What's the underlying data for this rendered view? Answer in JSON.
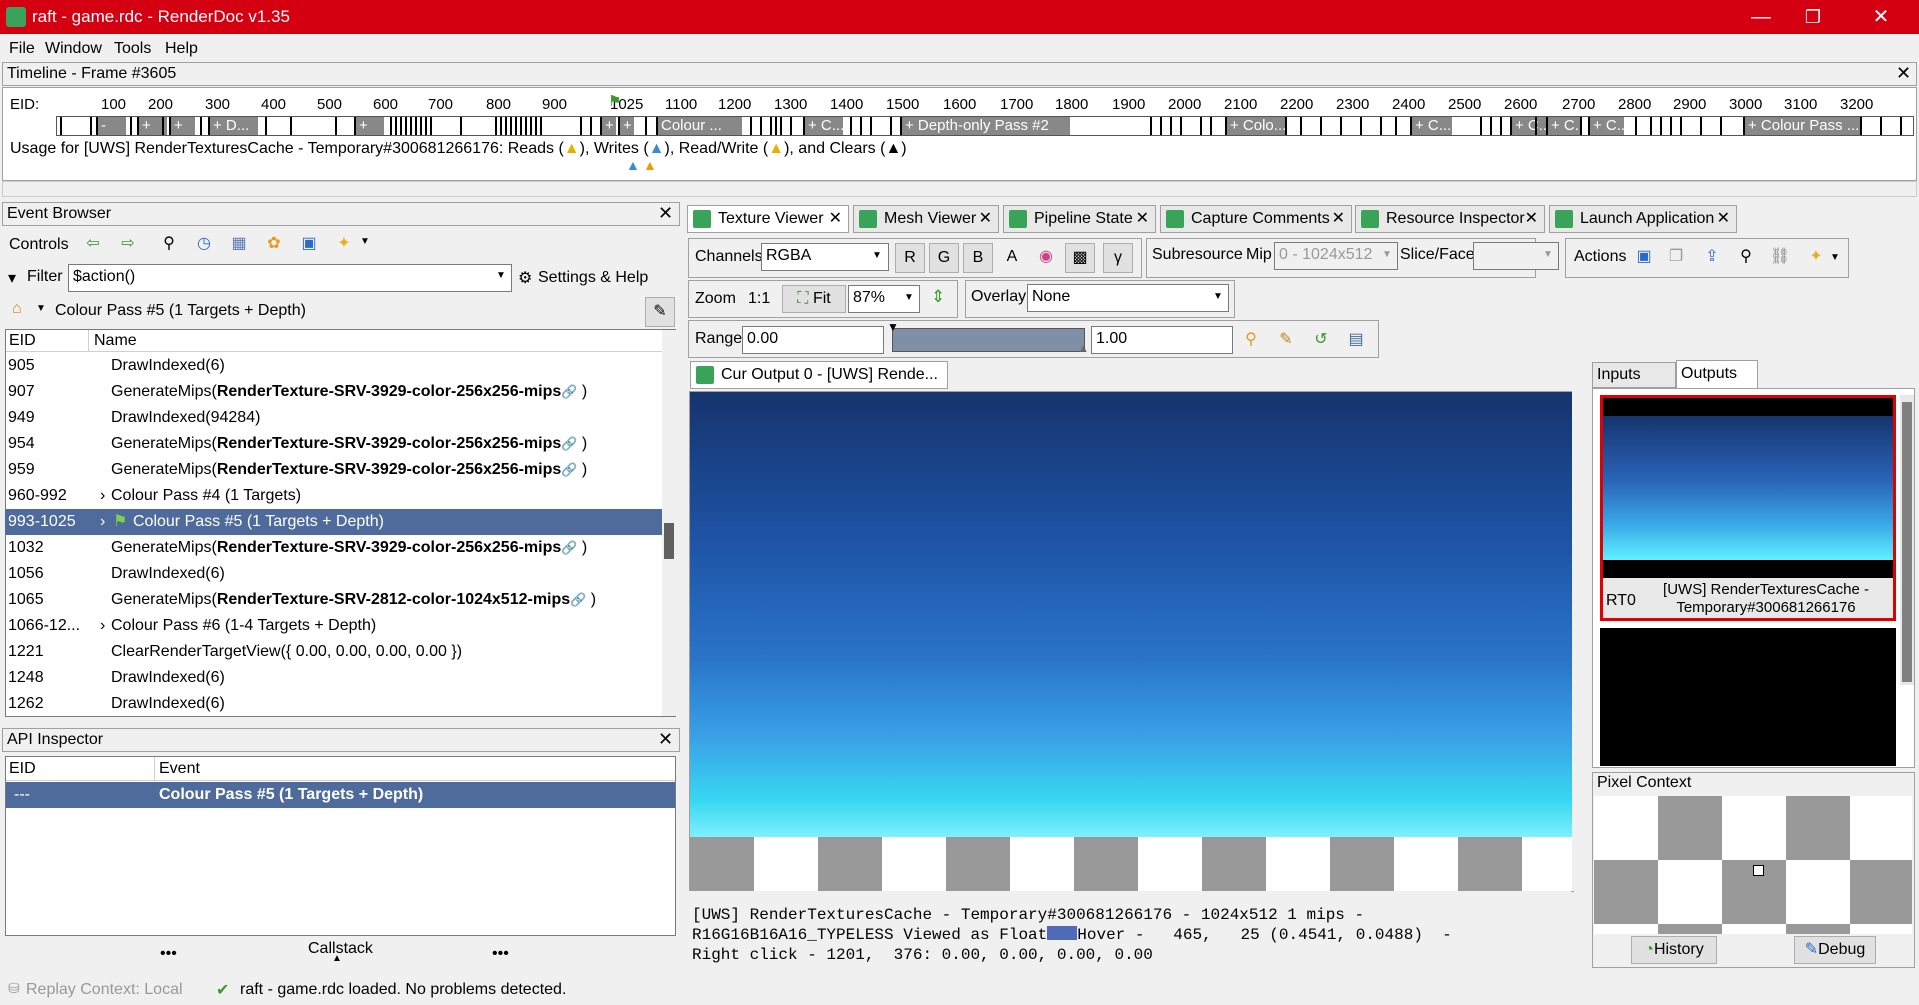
{
  "window": {
    "title": "raft - game.rdc - RenderDoc v1.35",
    "minimize": "—",
    "maximize": "❐",
    "close": "✕"
  },
  "menu": [
    "File",
    "Window",
    "Tools",
    "Help"
  ],
  "timeline": {
    "title": "Timeline - Frame #3605",
    "eid_label": "EID:",
    "ticks": [
      "100",
      "200",
      "300",
      "400",
      "500",
      "600",
      "700",
      "800",
      "900",
      "1025",
      "1100",
      "1200",
      "1300",
      "1400",
      "1500",
      "1600",
      "1700",
      "1800",
      "1900",
      "2000",
      "2100",
      "2200",
      "2300",
      "2400",
      "2500",
      "2600",
      "2700",
      "2800",
      "2900",
      "3000",
      "3100",
      "3200"
    ],
    "passes": [
      "-",
      "+",
      "+",
      "+ D...",
      "+",
      "+",
      "+",
      "Colour ...",
      "+ C...",
      "+ Depth-only Pass #2",
      "+ Colo...",
      "+ C...",
      "+ C...",
      "+ C...",
      "+ C...",
      "+ Colour Pass ..."
    ],
    "usage": "Usage for [UWS] RenderTexturesCache - Temporary#300681266176: Reads (",
    "usage_writes": "), Writes (",
    "usage_rw": "), Read/Write (",
    "usage_clears": "), and Clears (",
    "usage_end": ")"
  },
  "event_browser": {
    "title": "Event Browser",
    "controls": "Controls",
    "filter_label": "Filter",
    "filter_value": "$action()",
    "settings": "Settings & Help",
    "breadcrumb": "Colour Pass #5 (1 Targets + Depth)",
    "col_eid": "EID",
    "col_name": "Name",
    "rows": [
      {
        "eid": "905",
        "pre": "DrawIndexed(6)",
        "b": "",
        "post": ""
      },
      {
        "eid": "907",
        "pre": "GenerateMips(",
        "b": "RenderTexture-SRV-3929-color-256x256-mips",
        "post": " )"
      },
      {
        "eid": "949",
        "pre": "DrawIndexed(94284)",
        "b": "",
        "post": ""
      },
      {
        "eid": "954",
        "pre": "GenerateMips(",
        "b": "RenderTexture-SRV-3929-color-256x256-mips",
        "post": " )"
      },
      {
        "eid": "959",
        "pre": "GenerateMips(",
        "b": "RenderTexture-SRV-3929-color-256x256-mips",
        "post": " )"
      },
      {
        "eid": "960-992",
        "pre": "Colour Pass #4 (1 Targets)",
        "b": "",
        "post": ""
      },
      {
        "eid": "993-1025",
        "pre": "Colour Pass #5 (1 Targets + Depth)",
        "b": "",
        "post": ""
      },
      {
        "eid": "1032",
        "pre": "GenerateMips(",
        "b": "RenderTexture-SRV-3929-color-256x256-mips",
        "post": " )"
      },
      {
        "eid": "1056",
        "pre": "DrawIndexed(6)",
        "b": "",
        "post": ""
      },
      {
        "eid": "1065",
        "pre": "GenerateMips(",
        "b": "RenderTexture-SRV-2812-color-1024x512-mips",
        "post": " )"
      },
      {
        "eid": "1066-12...",
        "pre": "Colour Pass #6 (1-4 Targets + Depth)",
        "b": "",
        "post": ""
      },
      {
        "eid": "1221",
        "pre": "ClearRenderTargetView({ 0.00, 0.00, 0.00, 0.00 })",
        "b": "",
        "post": ""
      },
      {
        "eid": "1248",
        "pre": "DrawIndexed(6)",
        "b": "",
        "post": ""
      },
      {
        "eid": "1262",
        "pre": "DrawIndexed(6)",
        "b": "",
        "post": ""
      }
    ]
  },
  "api_inspector": {
    "title": "API Inspector",
    "col_eid": "EID",
    "col_event": "Event",
    "row_eid": "---",
    "row_event": "Colour Pass #5 (1 Targets + Depth)",
    "callstack": "Callstack",
    "dots": "•••"
  },
  "tabs": [
    "Texture Viewer",
    "Mesh Viewer",
    "Pipeline State",
    "Capture Comments",
    "Resource Inspector",
    "Launch Application"
  ],
  "texture_viewer": {
    "channels_label": "Channels",
    "channels_value": "RGBA",
    "ch_r": "R",
    "ch_g": "G",
    "ch_b": "B",
    "ch_a": "A",
    "gamma": "γ",
    "subresource": "Subresource",
    "mip": "Mip",
    "mip_value": "0 - 1024x512",
    "slice": "Slice/Face",
    "actions": "Actions",
    "zoom": "Zoom",
    "one_to_one": "1:1",
    "fit": "Fit",
    "zoom_value": "87%",
    "overlay": "Overlay",
    "overlay_value": "None",
    "range": "Range",
    "range_min": "0.00",
    "range_max": "1.00",
    "output_tab": "Cur Output 0 - [UWS] Rende...",
    "status1": "[UWS] RenderTexturesCache - Temporary#300681266176 - 1024x512 1 mips -",
    "status2a": "R16G16B16A16_TYPELESS Viewed as Float",
    "status2b": "Hover -   465,   25 (0.4541, 0.0488)  -",
    "status3": "Right click - 1201,  376: 0.00, 0.00, 0.00, 0.00"
  },
  "side": {
    "inputs": "Inputs",
    "outputs": "Outputs",
    "rt_label": "RT0",
    "rt_name": "[UWS] RenderTexturesCache - Temporary#300681266176",
    "pixel_context": "Pixel Context",
    "history": "History",
    "debug": "Debug"
  },
  "statusbar": {
    "replay": "Replay Context: Local",
    "message": "raft - game.rdc loaded. No problems detected."
  },
  "colors": {
    "titlebar": "#d40012",
    "selection": "#4f6b9c",
    "icon_green": "#3aa35a"
  }
}
